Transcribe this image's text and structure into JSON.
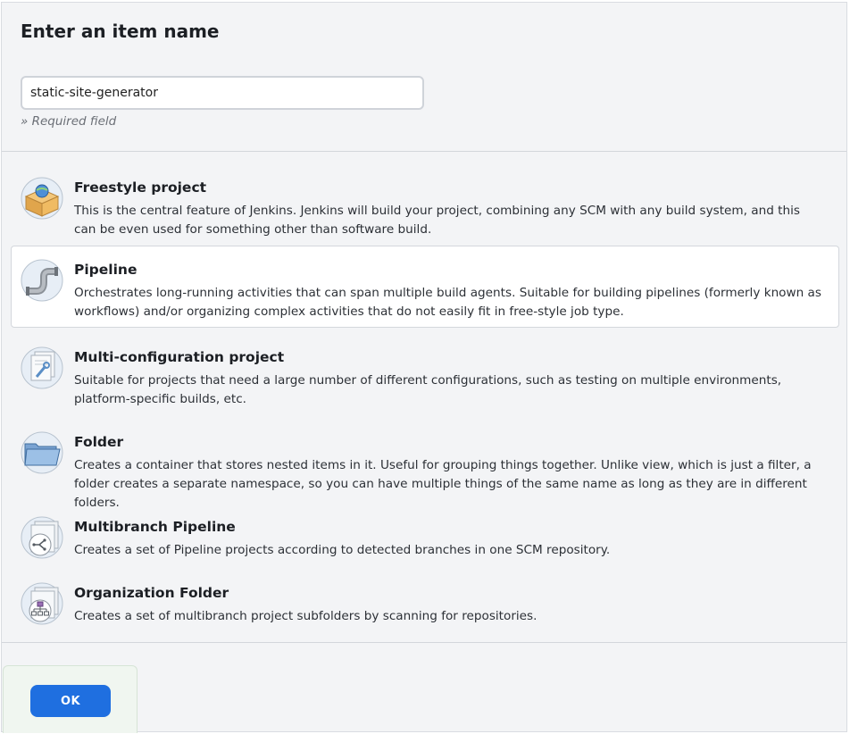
{
  "form": {
    "title": "Enter an item name",
    "item_name_value": "static-site-generator",
    "required_note": "» Required field"
  },
  "item_types": [
    {
      "name": "Freestyle project",
      "description": "This is the central feature of Jenkins. Jenkins will build your project, combining any SCM with any build system, and this can be even used for something other than software build.",
      "icon": "freestyle-project-icon",
      "selected": false
    },
    {
      "name": "Pipeline",
      "description": "Orchestrates long-running activities that can span multiple build agents. Suitable for building pipelines (formerly known as workflows) and/or organizing complex activities that do not easily fit in free-style job type.",
      "icon": "pipeline-icon",
      "selected": true
    },
    {
      "name": "Multi-configuration project",
      "description": "Suitable for projects that need a large number of different configurations, such as testing on multiple environments, platform-specific builds, etc.",
      "icon": "multi-configuration-icon",
      "selected": false
    },
    {
      "name": "Folder",
      "description": "Creates a container that stores nested items in it. Useful for grouping things together. Unlike view, which is just a filter, a folder creates a separate namespace, so you can have multiple things of the same name as long as they are in different folders.",
      "icon": "folder-icon",
      "selected": false
    },
    {
      "name": "Multibranch Pipeline",
      "description": "Creates a set of Pipeline projects according to detected branches in one SCM repository.",
      "icon": "multibranch-pipeline-icon",
      "selected": false
    },
    {
      "name": "Organization Folder",
      "description": "Creates a set of multibranch project subfolders by scanning for repositories.",
      "icon": "organization-folder-icon",
      "selected": false
    }
  ],
  "actions": {
    "ok_label": "OK"
  },
  "colors": {
    "accent": "#1f6fe0",
    "panel_background": "#f3f4f6",
    "selected_background": "#ffffff"
  }
}
